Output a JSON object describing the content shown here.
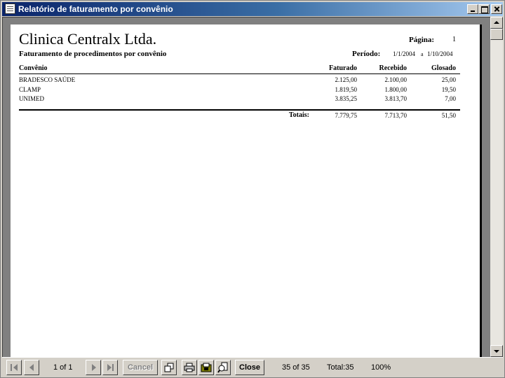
{
  "window": {
    "title": "Relatório de faturamento por convênio"
  },
  "report": {
    "company": "Clinica Centralx Ltda.",
    "page_label": "Página:",
    "page_value": "1",
    "title": "Faturamento de procedimentos por convênio",
    "period_label": "Período:",
    "period_start": "1/1/2004",
    "period_sep": "a",
    "period_end": "1/10/2004",
    "columns": [
      "Convênio",
      "Faturado",
      "Recebido",
      "Glosado"
    ],
    "rows": [
      {
        "convenio": "BRADESCO SAÚDE",
        "faturado": "2.125,00",
        "recebido": "2.100,00",
        "glosado": "25,00"
      },
      {
        "convenio": "CLAMP",
        "faturado": "1.819,50",
        "recebido": "1.800,00",
        "glosado": "19,50"
      },
      {
        "convenio": "UNIMED",
        "faturado": "3.835,25",
        "recebido": "3.813,70",
        "glosado": "7,00"
      }
    ],
    "totals_label": "Totais:",
    "totals": {
      "faturado": "7.779,75",
      "recebido": "7.713,70",
      "glosado": "51,50"
    }
  },
  "toolbar": {
    "page_indicator": "1 of 1",
    "cancel_label": "Cancel",
    "close_label": "Close",
    "records": "35 of 35",
    "total": "Total:35",
    "zoom": "100%"
  }
}
